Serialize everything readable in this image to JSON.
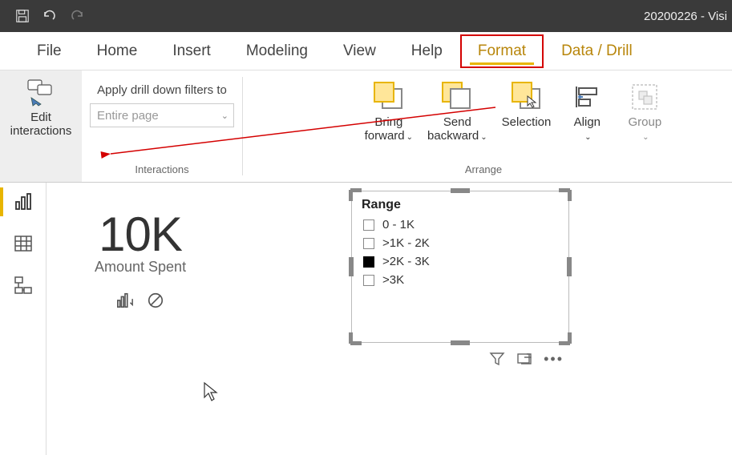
{
  "titlebar": {
    "title": "20200226 - Visi"
  },
  "menu": {
    "file": "File",
    "home": "Home",
    "insert": "Insert",
    "modeling": "Modeling",
    "view": "View",
    "help": "Help",
    "format": "Format",
    "data_drill": "Data / Drill"
  },
  "ribbon": {
    "edit_interactions": "Edit\ninteractions",
    "apply_label": "Apply drill down filters to",
    "apply_value": "Entire page",
    "interactions_label": "Interactions",
    "bring_forward": "Bring forward",
    "send_backward": "Send backward",
    "selection": "Selection",
    "align": "Align",
    "group": "Group",
    "arrange_label": "Arrange"
  },
  "card": {
    "value": "10K",
    "label": "Amount Spent"
  },
  "slicer": {
    "title": "Range",
    "items": [
      {
        "label": "0 - 1K",
        "selected": false
      },
      {
        "label": ">1K - 2K",
        "selected": false
      },
      {
        "label": ">2K - 3K",
        "selected": true
      },
      {
        "label": ">3K",
        "selected": false
      }
    ]
  }
}
